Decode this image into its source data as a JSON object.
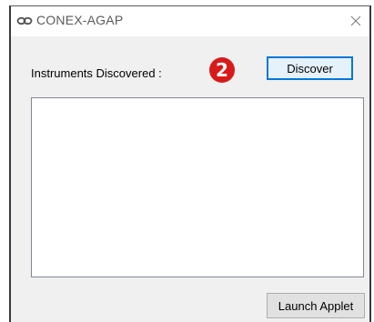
{
  "window": {
    "title": "CONEX-AGAP",
    "app_icon": "link-icon",
    "close_icon": "close-icon"
  },
  "main": {
    "instruments_label": "Instruments Discovered :",
    "step_badge": "2",
    "discover_label": "Discover",
    "launch_label": "Launch Applet",
    "instruments": []
  },
  "colors": {
    "badge": "#d81a1a",
    "focus_border": "#0078d7",
    "window_bg": "#f0f0f0"
  }
}
